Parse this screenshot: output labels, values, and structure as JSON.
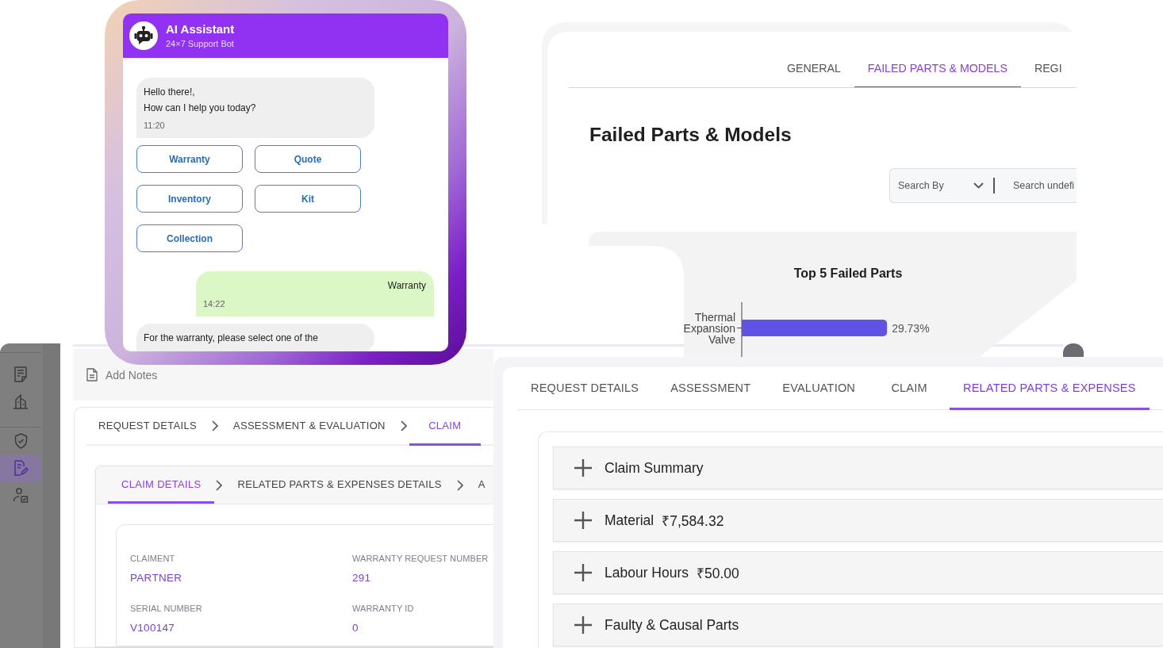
{
  "chat_widget": {
    "title": "AI Assistant",
    "subtitle": "24×7 Support Bot",
    "messages": [
      {
        "kind": "bot",
        "text": "Hello there!,\nHow can I help you today?",
        "time": "11:20"
      },
      {
        "kind": "options",
        "options": [
          "Warranty",
          "Quote",
          "Inventory",
          "Kit",
          "Collection"
        ]
      },
      {
        "kind": "user",
        "text": "Warranty",
        "time": "14:22"
      },
      {
        "kind": "bot",
        "text": "For the warranty, please select one of the"
      }
    ]
  },
  "failed_parts_panel": {
    "tabs": [
      {
        "label": "GENERAL",
        "selected": false
      },
      {
        "label": "FAILED PARTS & MODELS",
        "selected": true
      },
      {
        "label": "REGI",
        "selected": false
      }
    ],
    "heading": "Failed Parts & Models",
    "search_by_dropdown": {
      "label": "Search By"
    },
    "search_input": {
      "placeholder": "Search undefi"
    },
    "chart_data": {
      "type": "bar",
      "orientation": "horizontal",
      "title": "Top 5 Failed Parts",
      "categories": [
        "Thermal Expansion Valve"
      ],
      "values": [
        29.73
      ],
      "value_labels": [
        "29.73%"
      ]
    }
  },
  "claim_panel": {
    "sidebar": {
      "groups": [
        {
          "items": [
            {
              "selected": false
            },
            {
              "selected": false
            }
          ]
        },
        {
          "items": [
            {
              "selected": false
            },
            {
              "selected": true
            },
            {
              "selected": false
            }
          ]
        }
      ]
    },
    "add_notes": {
      "label": "Add Notes"
    },
    "steps": [
      {
        "label": "REQUEST DETAILS",
        "selected": false
      },
      {
        "label": "ASSESSMENT & EVALUATION",
        "selected": false
      },
      {
        "label": "CLAIM",
        "selected": true
      }
    ],
    "claim_tabs": [
      {
        "label": "CLAIM DETAILS",
        "selected": true
      },
      {
        "label": "RELATED PARTS & EXPENSES DETAILS",
        "selected": false
      },
      {
        "label": "A",
        "selected": false
      }
    ],
    "fields": [
      {
        "label": "CLAIMENT",
        "value": "PARTNER"
      },
      {
        "label": "WARRANTY REQUEST NUMBER",
        "value": "291"
      },
      {
        "label": "SERIAL NUMBER",
        "value": "V100147"
      },
      {
        "label": "WARRANTY ID",
        "value": "0"
      }
    ]
  },
  "expenses_panel": {
    "tabs": [
      {
        "label": "REQUEST DETAILS",
        "selected": false
      },
      {
        "label": "ASSESSMENT",
        "selected": false
      },
      {
        "label": "EVALUATION",
        "selected": false
      },
      {
        "label": "CLAIM",
        "selected": false
      },
      {
        "label": "RELATED PARTS & EXPENSES",
        "selected": true
      }
    ],
    "sections": [
      {
        "label": "Claim Summary",
        "expanded": false
      },
      {
        "label": "Material",
        "amount": "₹7,584.32",
        "expanded": false
      },
      {
        "label": "Labour Hours",
        "amount": "₹50.00",
        "expanded": false
      },
      {
        "label": "Faulty & Causal Parts",
        "expanded": false
      }
    ]
  }
}
